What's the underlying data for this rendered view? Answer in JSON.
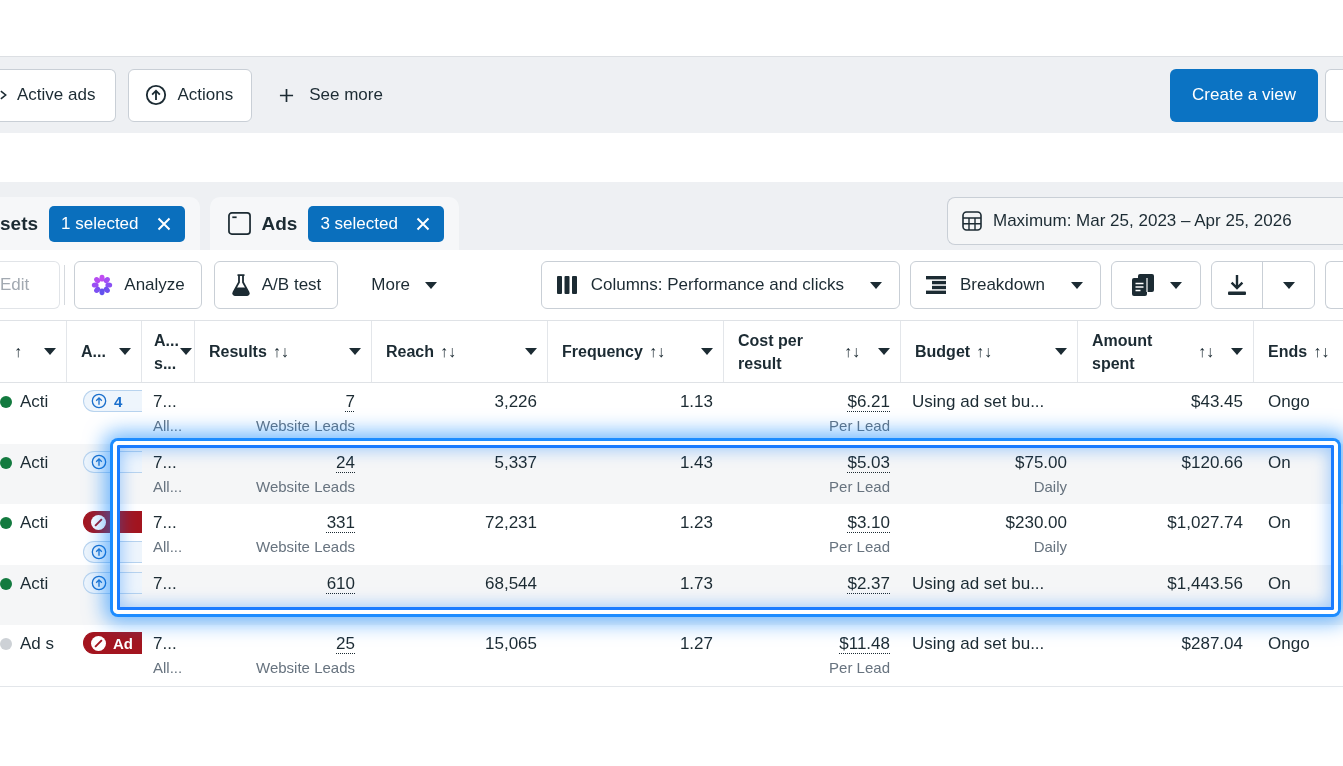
{
  "filter_bar": {
    "chips": [
      {
        "label": "Active ads"
      },
      {
        "label": "Actions"
      }
    ],
    "see_more": {
      "label": "See more"
    },
    "create_view_button": {
      "label": "Create a view"
    },
    "overflow_button": {
      "kind": "partial"
    }
  },
  "level_tabs": [
    {
      "label": "sets",
      "selection": "1 selected"
    },
    {
      "label": "Ads",
      "selection": "3 selected"
    }
  ],
  "date_range": {
    "label": "Maximum: Mar 25, 2023 – Apr 25, 2026"
  },
  "toolbar": {
    "groups": [
      [
        {
          "kind": "button",
          "label": "Edit",
          "disabled": true
        }
      ],
      [
        {
          "kind": "button",
          "label": "Analyze",
          "disabled": false
        },
        {
          "kind": "button",
          "label": "A/B test",
          "disabled": false
        },
        {
          "kind": "menu",
          "label": "More",
          "disabled": false
        }
      ],
      [
        {
          "kind": "dropdown",
          "label": "Columns: Performance and clicks",
          "disabled": false
        },
        {
          "kind": "dropdown",
          "label": "Breakdown",
          "disabled": false
        },
        {
          "kind": "icon-dropdown",
          "disabled": false
        },
        {
          "kind": "split",
          "disabled": false
        },
        {
          "kind": "partial",
          "disabled": false
        }
      ]
    ]
  },
  "table": {
    "columns": [
      {
        "sort": "↑",
        "menu": true
      },
      {
        "label": "A...",
        "menu": true
      },
      {
        "label": "A... s...",
        "menu": true
      },
      {
        "label": "Results",
        "sort": "↑↓",
        "menu": true
      },
      {
        "label": "Reach",
        "sort": "↑↓",
        "menu": true
      },
      {
        "label": "Frequency",
        "sort": "↑↓",
        "menu": true
      },
      {
        "label": "Cost per result",
        "sort": "↑↓",
        "menu": true
      },
      {
        "label": "Budget",
        "sort": "↑↓",
        "menu": true
      },
      {
        "label": "Amount spent",
        "sort": "↑↓",
        "menu": true
      },
      {
        "label": "Ends",
        "sort": "↑↓",
        "menu": false
      }
    ],
    "rows": [
      {
        "column_1": {
          "label": "Acti",
          "color": "#137a3f"
        },
        "column_2": [
          {
            "kind": "info",
            "text": "4"
          }
        ],
        "column_3": {
          "value": "7...",
          "sub": "All..."
        },
        "results": {
          "value": "7",
          "sub": "Website Leads"
        },
        "reach": "3,226",
        "frequency": "1.13",
        "cost_per_result": {
          "value": "$6.21",
          "sub": "Per Lead"
        },
        "budget": {
          "kind": "text",
          "value": "Using ad set bu..."
        },
        "amount_spent": "$43.45",
        "ends": "Ongo",
        "highlighted": false
      },
      {
        "column_1": {
          "label": "Acti",
          "color": "#137a3f"
        },
        "column_2": [
          {
            "kind": "info"
          }
        ],
        "column_3": {
          "value": "7...",
          "sub": "All..."
        },
        "results": {
          "value": "24",
          "sub": "Website Leads"
        },
        "reach": "5,337",
        "frequency": "1.43",
        "cost_per_result": {
          "value": "$5.03",
          "sub": "Per Lead"
        },
        "budget": {
          "kind": "amount",
          "value": "$75.00",
          "sub": "Daily"
        },
        "amount_spent": "$120.66",
        "ends": "On",
        "highlighted": true
      },
      {
        "column_1": {
          "label": "Acti",
          "color": "#137a3f"
        },
        "column_2": [
          {
            "kind": "alert"
          },
          {
            "kind": "info"
          }
        ],
        "column_3": {
          "value": "7...",
          "sub": "All..."
        },
        "results": {
          "value": "331",
          "sub": "Website Leads"
        },
        "reach": "72,231",
        "frequency": "1.23",
        "cost_per_result": {
          "value": "$3.10",
          "sub": "Per Lead"
        },
        "budget": {
          "kind": "amount",
          "value": "$230.00",
          "sub": "Daily"
        },
        "amount_spent": "$1,027.74",
        "ends": "On",
        "highlighted": true
      },
      {
        "column_1": {
          "label": "Acti",
          "color": "#137a3f"
        },
        "column_2": [
          {
            "kind": "info"
          }
        ],
        "column_3": {
          "value": "7..."
        },
        "results": {
          "value": "610"
        },
        "reach": "68,544",
        "frequency": "1.73",
        "cost_per_result": {
          "value": "$2.37"
        },
        "budget": {
          "kind": "text",
          "value": "Using ad set bu..."
        },
        "amount_spent": "$1,443.56",
        "ends": "On",
        "highlighted": true
      },
      {
        "column_1": {
          "label": "Ad s",
          "color": "#cdd1d6"
        },
        "column_2": [
          {
            "kind": "alert",
            "text": "Ad"
          }
        ],
        "column_3": {
          "value": "7...",
          "sub": "All..."
        },
        "results": {
          "value": "25",
          "sub": "Website Leads"
        },
        "reach": "15,065",
        "frequency": "1.27",
        "cost_per_result": {
          "value": "$11.48",
          "sub": "Per Lead"
        },
        "budget": {
          "kind": "text",
          "value": "Using ad set bu..."
        },
        "amount_spent": "$287.04",
        "ends": "Ongo",
        "highlighted": false
      }
    ]
  }
}
